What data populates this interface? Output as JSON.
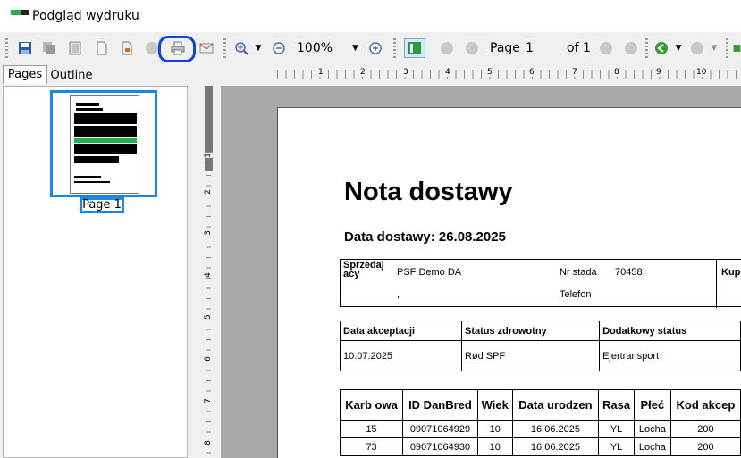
{
  "window": {
    "title": "Podgląd wydruku"
  },
  "toolbar": {
    "zoom_value": "100%",
    "page_label": "Page",
    "page_value": "1",
    "of_label": "of 1"
  },
  "tabs": [
    {
      "label": "Pages"
    },
    {
      "label": "Outline"
    }
  ],
  "ruler": {
    "horizontal_numbers": [
      "1",
      "2",
      "3",
      "4",
      "5",
      "6",
      "7",
      "8",
      "9",
      "10"
    ],
    "vertical_numbers": [
      "1",
      "2",
      "3",
      "4",
      "5",
      "6",
      "7",
      "8"
    ]
  },
  "thumbnail": {
    "label": "Page 1"
  },
  "document": {
    "title": "Nota dostawy",
    "delivery_date": "Data dostawy: 26.08.2025",
    "seller": {
      "label": "Sprzedaj acy",
      "name": "PSF Demo DA",
      "comma": ",",
      "herd_label": "Nr stada",
      "herd_value": "70458",
      "phone_label": "Telefon",
      "buyer_label": "Kup"
    },
    "status_table": {
      "headers": [
        "Data akceptacji",
        "Status zdrowotny",
        "Dodatkowy status"
      ],
      "values": [
        "10.07.2025",
        "Rød SPF",
        "Ejertransport"
      ]
    },
    "animals_table": {
      "headers": [
        "Karb owa",
        "ID DanBred",
        "Wiek",
        "Data urodzen",
        "Rasa",
        "Płeć",
        "Kod akcep"
      ],
      "rows": [
        [
          "15",
          "09071064929",
          "10",
          "16.06.2025",
          "YL",
          "Locha",
          "200"
        ],
        [
          "73",
          "09071064930",
          "10",
          "16.06.2025",
          "YL",
          "Locha",
          "200"
        ]
      ]
    }
  },
  "colors": {
    "highlight": "#1144dd",
    "selection": "#1a88e0",
    "preview_bg": "#a9a9a9"
  }
}
